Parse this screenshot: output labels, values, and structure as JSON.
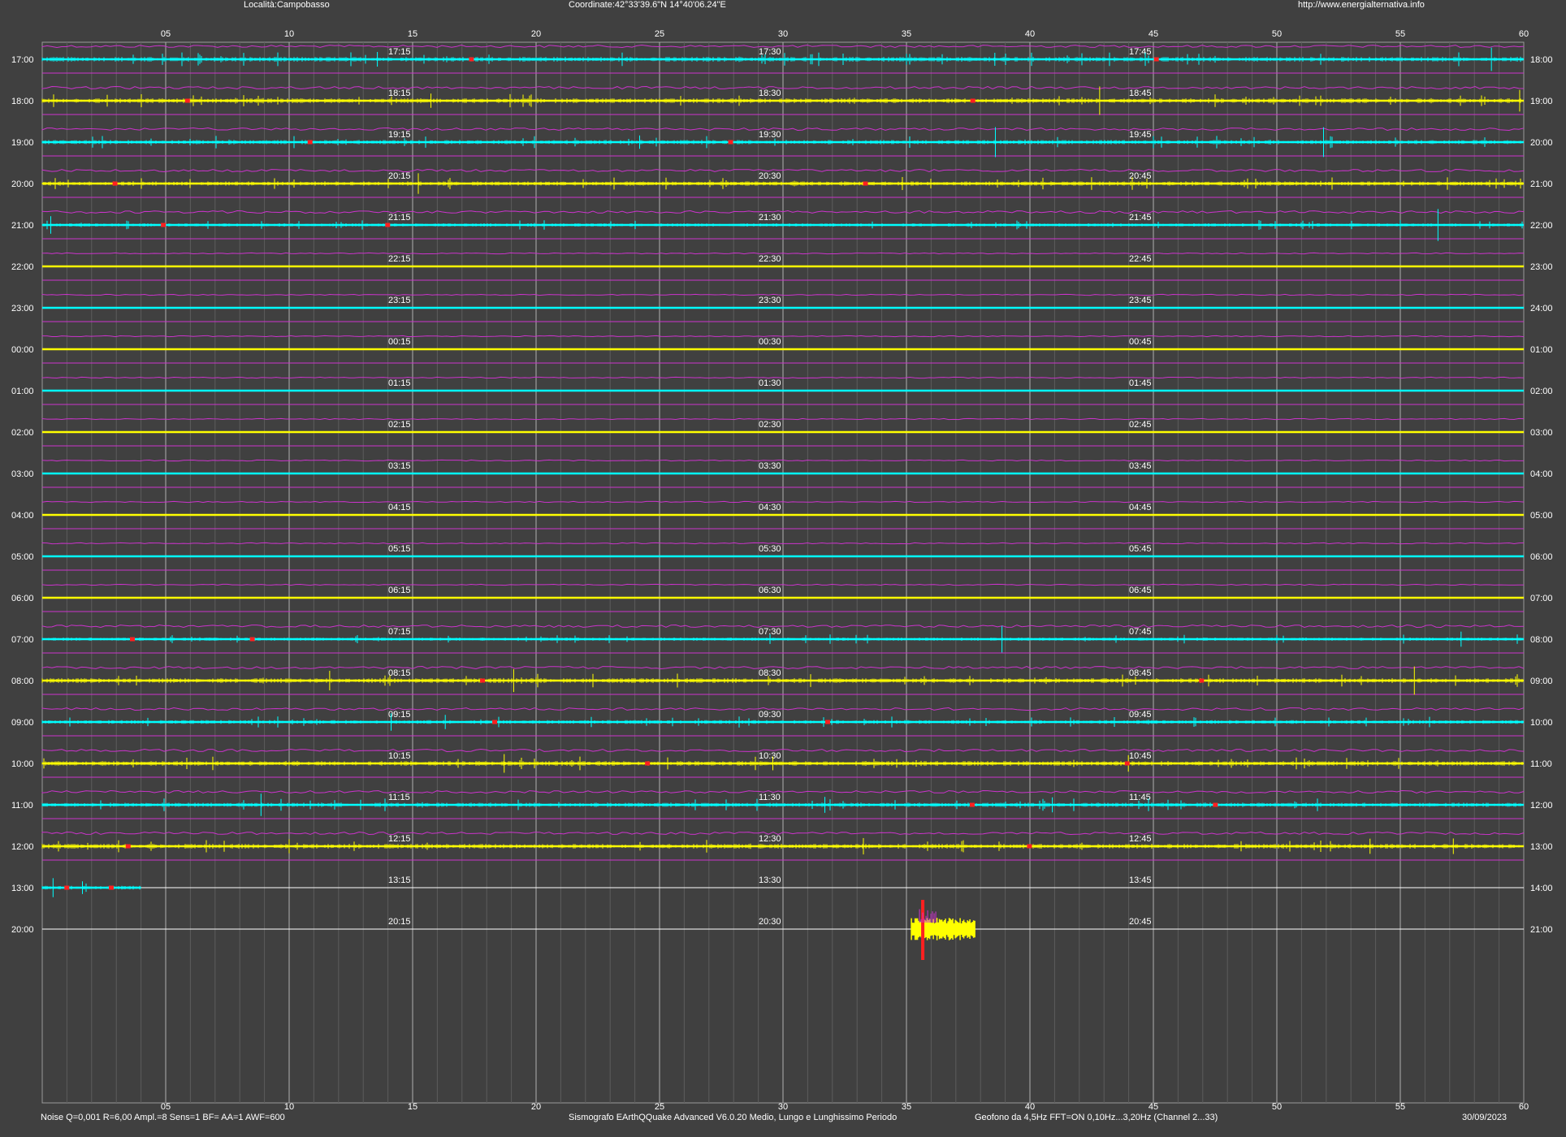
{
  "header": {
    "location": "Località:Campobasso",
    "coordinates": "Coordinate:42°33'39.6\"N  14°40'06.24\"E",
    "url": "http://www.energialternativa.info"
  },
  "footer": {
    "params": "Noise Q=0,001 R=6,00 Ampl.=8 Sens=1 BF= AA=1 AWF=600",
    "software": "Sismografo  EArthQQuake Advanced V6.0.20  Medio, Lungo e Lunghissimo Periodo",
    "sensor": "Geofono da 4,5Hz FFT=ON 0,10Hz...3,20Hz      (Channel 2...33)",
    "date": "30/09/2023"
  },
  "minute_axis": [
    "05",
    "10",
    "15",
    "20",
    "25",
    "30",
    "35",
    "40",
    "45",
    "50",
    "55",
    "60"
  ],
  "colors": {
    "background": "#404040",
    "trace_a": "#00ffff",
    "trace_b": "#ffff00",
    "long_period": "#cc33cc",
    "event_marker": "#ff2020",
    "grid": "#9a9a9a"
  },
  "rows": [
    {
      "left": "17:00",
      "right": "18:00",
      "q": [
        "17:15",
        "17:30",
        "17:45"
      ],
      "color": "cyan",
      "activity": 0.8
    },
    {
      "left": "18:00",
      "right": "19:00",
      "q": [
        "18:15",
        "18:30",
        "18:45"
      ],
      "color": "yellow",
      "activity": 0.8
    },
    {
      "left": "19:00",
      "right": "20:00",
      "q": [
        "19:15",
        "19:30",
        "19:45"
      ],
      "color": "cyan",
      "activity": 0.7
    },
    {
      "left": "20:00",
      "right": "21:00",
      "q": [
        "20:15",
        "20:30",
        "20:45"
      ],
      "color": "yellow",
      "activity": 0.7
    },
    {
      "left": "21:00",
      "right": "22:00",
      "q": [
        "21:15",
        "21:30",
        "21:45"
      ],
      "color": "cyan",
      "activity": 0.5
    },
    {
      "left": "22:00",
      "right": "23:00",
      "q": [
        "22:15",
        "22:30",
        "22:45"
      ],
      "color": "yellow",
      "activity": 0
    },
    {
      "left": "23:00",
      "right": "24:00",
      "q": [
        "23:15",
        "23:30",
        "23:45"
      ],
      "color": "cyan",
      "activity": 0
    },
    {
      "left": "00:00",
      "right": "01:00",
      "q": [
        "00:15",
        "00:30",
        "00:45"
      ],
      "color": "yellow",
      "activity": 0
    },
    {
      "left": "01:00",
      "right": "02:00",
      "q": [
        "01:15",
        "01:30",
        "01:45"
      ],
      "color": "cyan",
      "activity": 0
    },
    {
      "left": "02:00",
      "right": "03:00",
      "q": [
        "02:15",
        "02:30",
        "02:45"
      ],
      "color": "yellow",
      "activity": 0
    },
    {
      "left": "03:00",
      "right": "04:00",
      "q": [
        "03:15",
        "03:30",
        "03:45"
      ],
      "color": "cyan",
      "activity": 0
    },
    {
      "left": "04:00",
      "right": "05:00",
      "q": [
        "04:15",
        "04:30",
        "04:45"
      ],
      "color": "yellow",
      "activity": 0
    },
    {
      "left": "05:00",
      "right": "06:00",
      "q": [
        "05:15",
        "05:30",
        "05:45"
      ],
      "color": "cyan",
      "activity": 0
    },
    {
      "left": "06:00",
      "right": "07:00",
      "q": [
        "06:15",
        "06:30",
        "06:45"
      ],
      "color": "yellow",
      "activity": 0
    },
    {
      "left": "07:00",
      "right": "08:00",
      "q": [
        "07:15",
        "07:30",
        "07:45"
      ],
      "color": "cyan",
      "activity": 0.5
    },
    {
      "left": "08:00",
      "right": "09:00",
      "q": [
        "08:15",
        "08:30",
        "08:45"
      ],
      "color": "yellow",
      "activity": 0.8
    },
    {
      "left": "09:00",
      "right": "10:00",
      "q": [
        "09:15",
        "09:30",
        "09:45"
      ],
      "color": "cyan",
      "activity": 0.6
    },
    {
      "left": "10:00",
      "right": "11:00",
      "q": [
        "10:15",
        "10:30",
        "10:45"
      ],
      "color": "yellow",
      "activity": 0.8
    },
    {
      "left": "11:00",
      "right": "12:00",
      "q": [
        "11:15",
        "11:30",
        "11:45"
      ],
      "color": "cyan",
      "activity": 0.7
    },
    {
      "left": "12:00",
      "right": "13:00",
      "q": [
        "12:15",
        "12:30",
        "12:45"
      ],
      "color": "yellow",
      "activity": 0.8
    },
    {
      "left": "13:00",
      "right": "14:00",
      "q": [
        "13:15",
        "13:30",
        "13:45"
      ],
      "color": "cyan",
      "activity": 0.6,
      "end_minute": 4
    },
    {
      "left": "20:00",
      "right": "21:00",
      "q": [
        "20:15",
        "20:30",
        "20:45"
      ],
      "color": "none",
      "activity": 0
    }
  ]
}
